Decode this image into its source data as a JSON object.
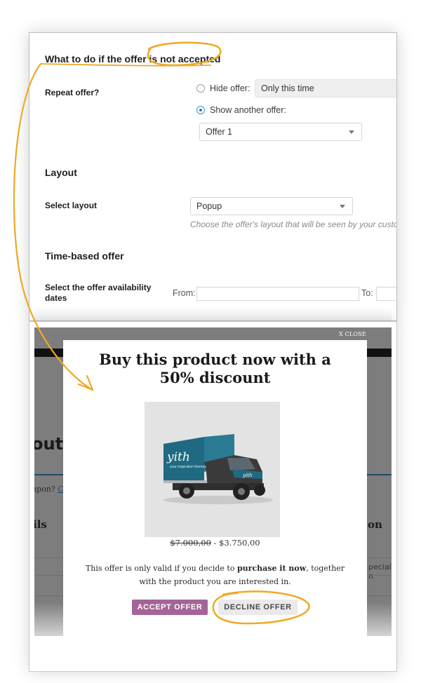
{
  "settings": {
    "section_not_accepted": "What to do if the offer is not accepted",
    "repeat_offer_label": "Repeat offer?",
    "hide_offer_label": "Hide offer:",
    "hide_offer_value": "Only this time",
    "show_another_label": "Show another offer:",
    "show_another_selected": true,
    "hide_offer_selected": false,
    "another_offer_value": "Offer 1",
    "section_layout": "Layout",
    "select_layout_label": "Select layout",
    "layout_value": "Popup",
    "layout_hint": "Choose the offer's layout that will be seen by your custor",
    "section_time": "Time-based offer",
    "availability_label_line1": "Select the offer availability",
    "availability_label_line2": "dates",
    "from_label": "From:",
    "from_value": "",
    "to_label": "To:",
    "to_value": ""
  },
  "background_page": {
    "heading_fragment": "out",
    "coupon_text": "upon?",
    "coupon_link": "C",
    "details_fragment": "ils",
    "right_heading_fragment": "on",
    "right_field_fragment": "pecial n"
  },
  "popup": {
    "close_label": "X CLOSE",
    "title": "Buy this product now with a 50% discount",
    "product_image_alt": "yith delivery truck",
    "truck_brand": "yith",
    "truck_tagline": "your inspiration themes",
    "old_price": "$7.000,00",
    "price_separator": " - ",
    "new_price": "$3.750,00",
    "offer_text_before": "This offer is only valid if you decide to ",
    "offer_text_bold": "purchase it now",
    "offer_text_after": ", together with the product you are interested in.",
    "accept_label": "ACCEPT OFFER",
    "decline_label": "DECLINE OFFER"
  },
  "colors": {
    "accent_accept": "#a46497",
    "decline_bg": "#ebe9eb",
    "annotation": "#f0a824",
    "radio_checked": "#2b7bb9"
  }
}
